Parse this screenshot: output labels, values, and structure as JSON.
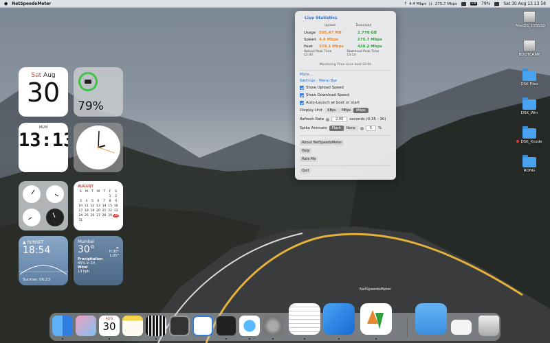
{
  "menubar": {
    "app_name": "NetSpeedoMeter",
    "upload_speed": "4.4 Mbps",
    "download_speed": "275.7 Mbps",
    "battery": "79%",
    "badge": "EN",
    "datetime": "Sat 30 Aug  13 13 58"
  },
  "panel": {
    "title": "Live Statistics",
    "col_upload": "Upload",
    "col_download": "Download",
    "rows": [
      {
        "label": "Usage",
        "upload": "595.47 MB",
        "download": "2.778 GB"
      },
      {
        "label": "Speed",
        "upload": "4.4 Mbps",
        "download": "275.7 Mbps"
      },
      {
        "label": "Peak",
        "upload": "378.1 Mbps",
        "download": "430.2 Mbps"
      }
    ],
    "upload_peak_label": "Upload Peak Time",
    "upload_peak_time": "12:40",
    "download_peak_label": "Download Peak Time",
    "download_peak_time": "13:13",
    "monitoring": "Monitoring Time since boot 02:0h",
    "more": "More...",
    "settings_title": "Settings - Menu Bar",
    "check_upload": "Show Upload Speed",
    "check_download": "Show Download Speed",
    "check_autolaunch": "Auto-Launch at boot or start",
    "display_unit_label": "Display Unit",
    "units": [
      "KBps",
      "MBps",
      "Mbps"
    ],
    "selected_unit": "Mbps",
    "refresh_label": "Refresh Rate",
    "refresh_value": "2.00",
    "refresh_suffix": "seconds (0.35 - 30)",
    "spike_label": "Spike Animate",
    "spike_options": [
      "Flash",
      "None"
    ],
    "spike_value": "5",
    "spike_suffix": "%",
    "about_button": "About NetSpeedoMeter",
    "help_button": "Help",
    "rate_button": "Rate Me",
    "quit_button": "Quit"
  },
  "widgets": {
    "date_day": "Sat",
    "date_month": "Aug",
    "date_num": "30",
    "battery_pct": "79%",
    "clock_city": "MUM",
    "clock_time": "13:13",
    "calendar_month": "AUGUST",
    "calendar_days": [
      "S",
      "M",
      "T",
      "W",
      "T",
      "F",
      "S"
    ],
    "calendar_weeks": [
      [
        "",
        "",
        "",
        "",
        "",
        "1",
        "2"
      ],
      [
        "3",
        "4",
        "5",
        "6",
        "7",
        "8",
        "9"
      ],
      [
        "10",
        "11",
        "12",
        "13",
        "14",
        "15",
        "16"
      ],
      [
        "17",
        "18",
        "19",
        "20",
        "21",
        "22",
        "23"
      ],
      [
        "24",
        "25",
        "26",
        "27",
        "28",
        "29",
        "30"
      ],
      [
        "31",
        "",
        "",
        "",
        "",
        "",
        ""
      ]
    ],
    "calendar_today": "30",
    "sunset_label": "SUNSET",
    "sunset_time": "18:54",
    "sunrise": "Sunrise: 06:23",
    "weather_city": "Mumbai",
    "weather_temp": "30°",
    "weather_hi": "H:30°",
    "weather_lo": "L:25°",
    "precip_label": "Precipitation",
    "precip_value": "45% in 1h",
    "wind_label": "Wind",
    "wind_value": "13 kph"
  },
  "desktop": {
    "icons": [
      {
        "label": "MacOS_1TBSSD"
      },
      {
        "label": "BOOTCAMP"
      },
      {
        "label": "DSK Files"
      },
      {
        "label": "DSK_Win"
      },
      {
        "label": "DSK_Xcode"
      },
      {
        "label": "RDNG"
      }
    ]
  },
  "dock": {
    "tooltip": "NetSpeedoMeter",
    "calendar_month": "AUG",
    "calendar_day": "30",
    "icons": [
      "finder-icon",
      "launchpad-icon",
      "calendar-icon",
      "notes-icon",
      "piano-icon",
      "calculator-icon",
      "app-store-icon",
      "terminal-icon",
      "safari-icon",
      "system-settings-icon",
      "textedit-icon",
      "xcode-icon",
      "netspeedometer-icon",
      "downloads-icon",
      "preview-icon",
      "trash-icon"
    ]
  }
}
